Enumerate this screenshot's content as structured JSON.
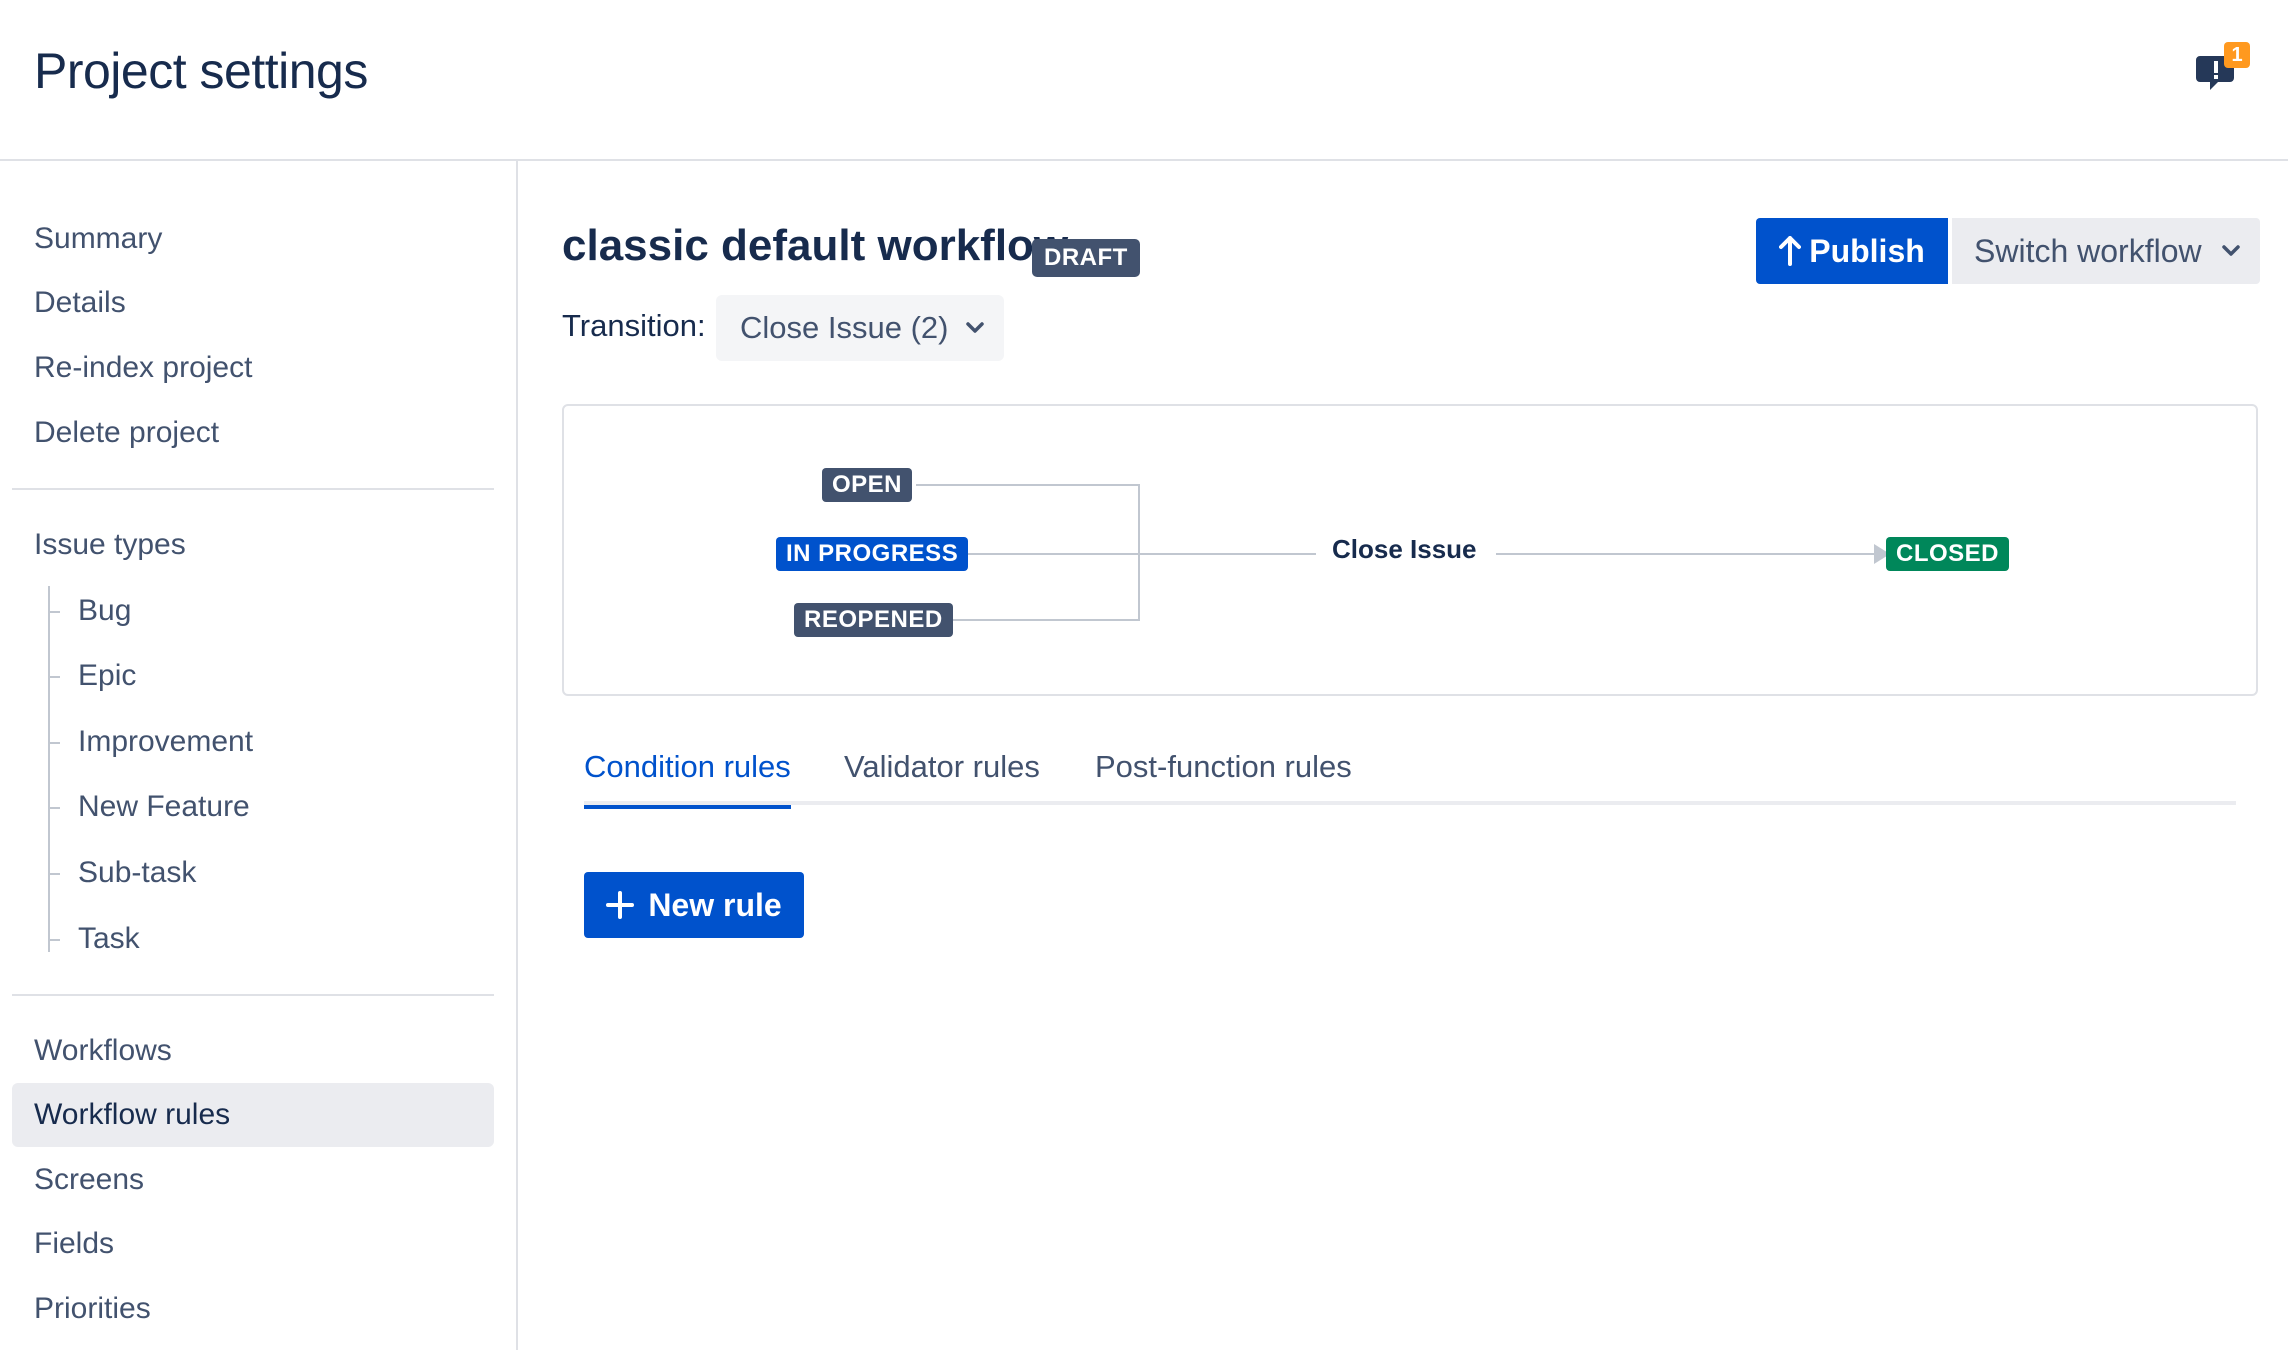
{
  "header": {
    "title": "Project settings",
    "notification_count": "1",
    "icons": {
      "notification": "feedback-icon"
    }
  },
  "sidebar": {
    "group1": [
      "Summary",
      "Details",
      "Re-index project",
      "Delete project"
    ],
    "issue_types_label": "Issue types",
    "issue_types": [
      "Bug",
      "Epic",
      "Improvement",
      "New Feature",
      "Sub-task",
      "Task"
    ],
    "group3": [
      "Workflows",
      "Workflow rules",
      "Screens",
      "Fields",
      "Priorities"
    ],
    "active_item": "Workflow rules"
  },
  "main": {
    "workflow_title": "classic default workflow",
    "status_badge": "DRAFT",
    "transition_label": "Transition:",
    "transition_value": "Close Issue (2)",
    "publish_label": "Publish",
    "switch_label": "Switch workflow",
    "diagram": {
      "from_statuses": [
        "OPEN",
        "IN PROGRESS",
        "REOPENED"
      ],
      "transition_name": "Close Issue",
      "to_status": "CLOSED"
    },
    "tabs": [
      "Condition rules",
      "Validator rules",
      "Post-function rules"
    ],
    "active_tab": "Condition rules",
    "new_rule_label": "New rule"
  },
  "colors": {
    "primary": "#0052cc",
    "text": "#172b4d",
    "subtle_text": "#42526e",
    "status_grey": "#42526e",
    "status_green": "#00875a",
    "notification_badge": "#ff991f"
  }
}
